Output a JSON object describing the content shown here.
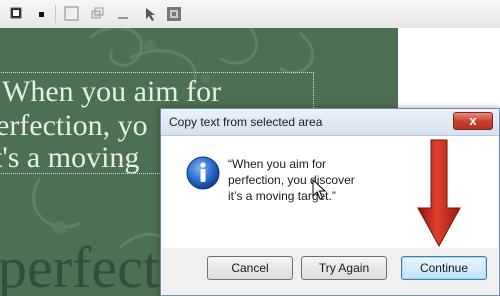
{
  "toolbar": {
    "icons": [
      "black-square-icon",
      "small-square-icon",
      "window-icon",
      "restore-icon",
      "minimize-icon",
      "pointer-icon",
      "frame-icon"
    ]
  },
  "background": {
    "quote_lines": [
      "When you aim for",
      "erfection, yo",
      "t's a moving"
    ],
    "big_word": "perfectio"
  },
  "dialog": {
    "title": "Copy text from selected area",
    "close_label": "x",
    "message": "“When you aim for\nperfection, you discover\nit’s a moving target.”",
    "buttons": {
      "cancel": "Cancel",
      "try_again": "Try Again",
      "continue": "Continue"
    }
  },
  "colors": {
    "background_green": "#4d6f52",
    "arrow_red": "#c0271b",
    "info_blue": "#1f5fbf"
  }
}
